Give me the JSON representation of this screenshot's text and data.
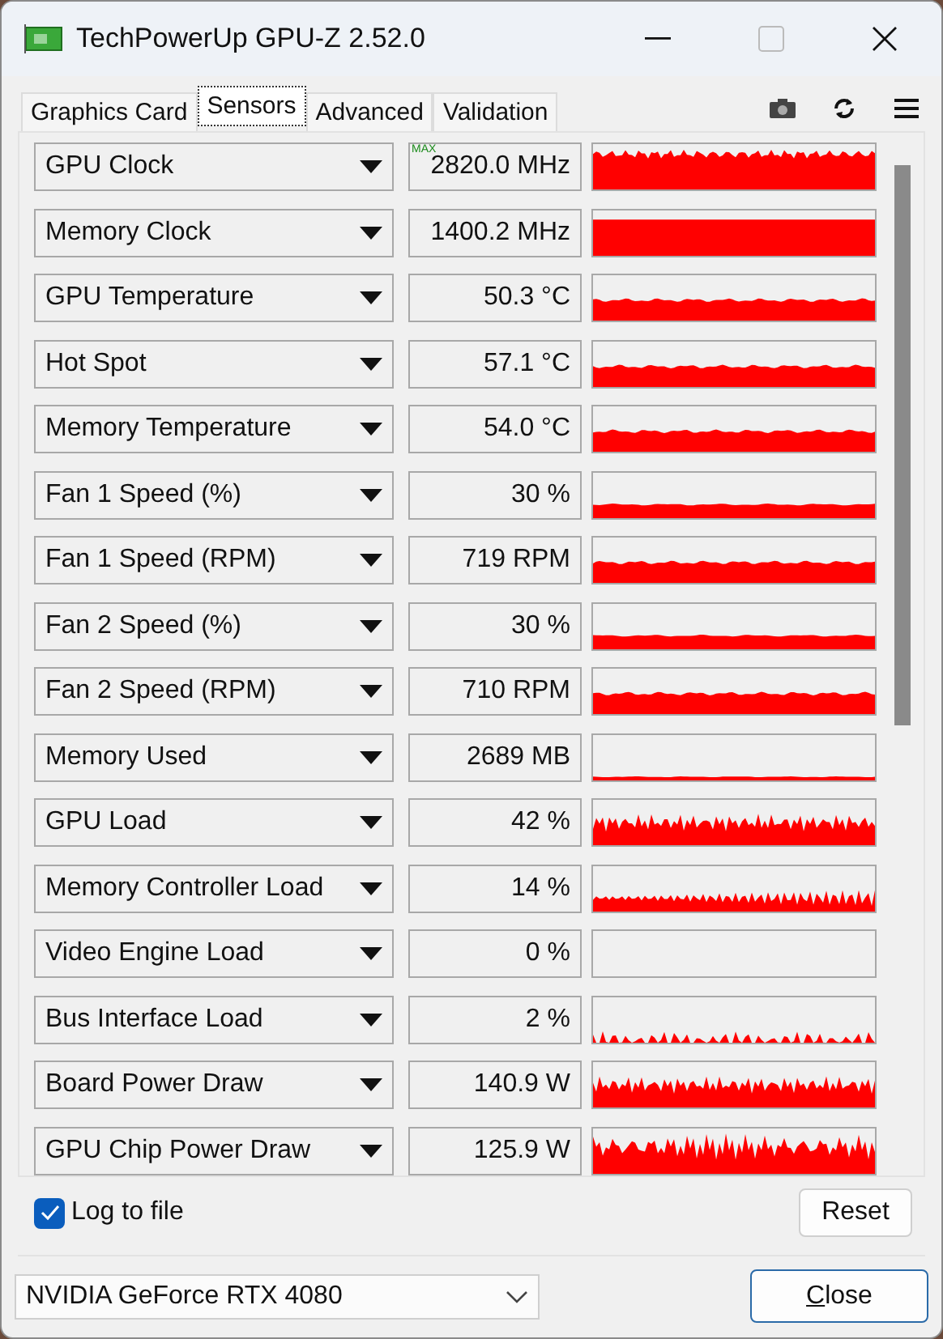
{
  "window": {
    "title": "TechPowerUp GPU-Z 2.52.0"
  },
  "tabs": [
    {
      "label": "Graphics Card",
      "selected": false
    },
    {
      "label": "Sensors",
      "selected": true
    },
    {
      "label": "Advanced",
      "selected": false
    },
    {
      "label": "Validation",
      "selected": false
    }
  ],
  "sensors": [
    {
      "name": "GPU Clock",
      "value": "2820.0 MHz",
      "badge": "MAX",
      "kind": "high-jagged"
    },
    {
      "name": "Memory Clock",
      "value": "1400.2 MHz",
      "kind": "full"
    },
    {
      "name": "GPU Temperature",
      "value": "50.3 °C",
      "kind": "mid"
    },
    {
      "name": "Hot Spot",
      "value": "57.1 °C",
      "kind": "mid"
    },
    {
      "name": "Memory Temperature",
      "value": "54.0 °C",
      "kind": "mid"
    },
    {
      "name": "Fan 1 Speed (%)",
      "value": "30 %",
      "kind": "low"
    },
    {
      "name": "Fan 1 Speed (RPM)",
      "value": "719 RPM",
      "kind": "mid"
    },
    {
      "name": "Fan 2 Speed (%)",
      "value": "30 %",
      "kind": "low"
    },
    {
      "name": "Fan 2 Speed (RPM)",
      "value": "710 RPM",
      "kind": "mid"
    },
    {
      "name": "Memory Used",
      "value": "2689 MB",
      "kind": "flat-low"
    },
    {
      "name": "GPU Load",
      "value": "42 %",
      "kind": "noisy-mid"
    },
    {
      "name": "Memory Controller Load",
      "value": "14 %",
      "kind": "noisy-low"
    },
    {
      "name": "Video Engine Load",
      "value": "0 %",
      "kind": "empty"
    },
    {
      "name": "Bus Interface Load",
      "value": "2 %",
      "kind": "sparse"
    },
    {
      "name": "Board Power Draw",
      "value": "140.9 W",
      "kind": "noisy-mid"
    },
    {
      "name": "GPU Chip Power Draw",
      "value": "125.9 W",
      "kind": "noisy-high"
    }
  ],
  "log_to_file": {
    "label": "Log to file",
    "checked": true
  },
  "reset_button": "Reset",
  "device_select": {
    "value": "NVIDIA GeForce RTX 4080"
  },
  "close_button": "Close"
}
